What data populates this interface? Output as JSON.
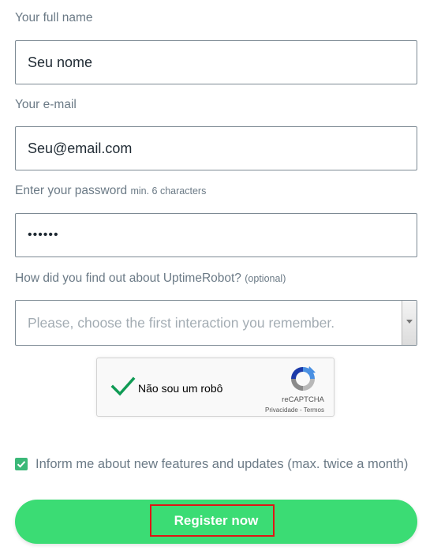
{
  "form": {
    "name": {
      "label": "Your full name",
      "value": "Seu nome"
    },
    "email": {
      "label": "Your e-mail",
      "value": "Seu@email.com"
    },
    "password": {
      "label": "Enter your password",
      "hint": "min. 6 characters",
      "value": "••••••"
    },
    "source": {
      "label": "How did you find out about UptimeRobot?",
      "hint": "(optional)",
      "placeholder": "Please, choose the first interaction you remember."
    },
    "captcha": {
      "text": "Não sou um robô",
      "brand": "reCAPTCHA",
      "privacy": "Privacidade",
      "separator": " - ",
      "terms": "Termos",
      "checked": true
    },
    "newsletter": {
      "label": "Inform me about new features and updates (max. twice a month)",
      "checked": true
    },
    "submit": {
      "label": "Register now"
    }
  },
  "colors": {
    "accent": "#3bdc74",
    "checkbox": "#3bb878",
    "highlight": "#e01515",
    "label": "#6b7a86"
  }
}
